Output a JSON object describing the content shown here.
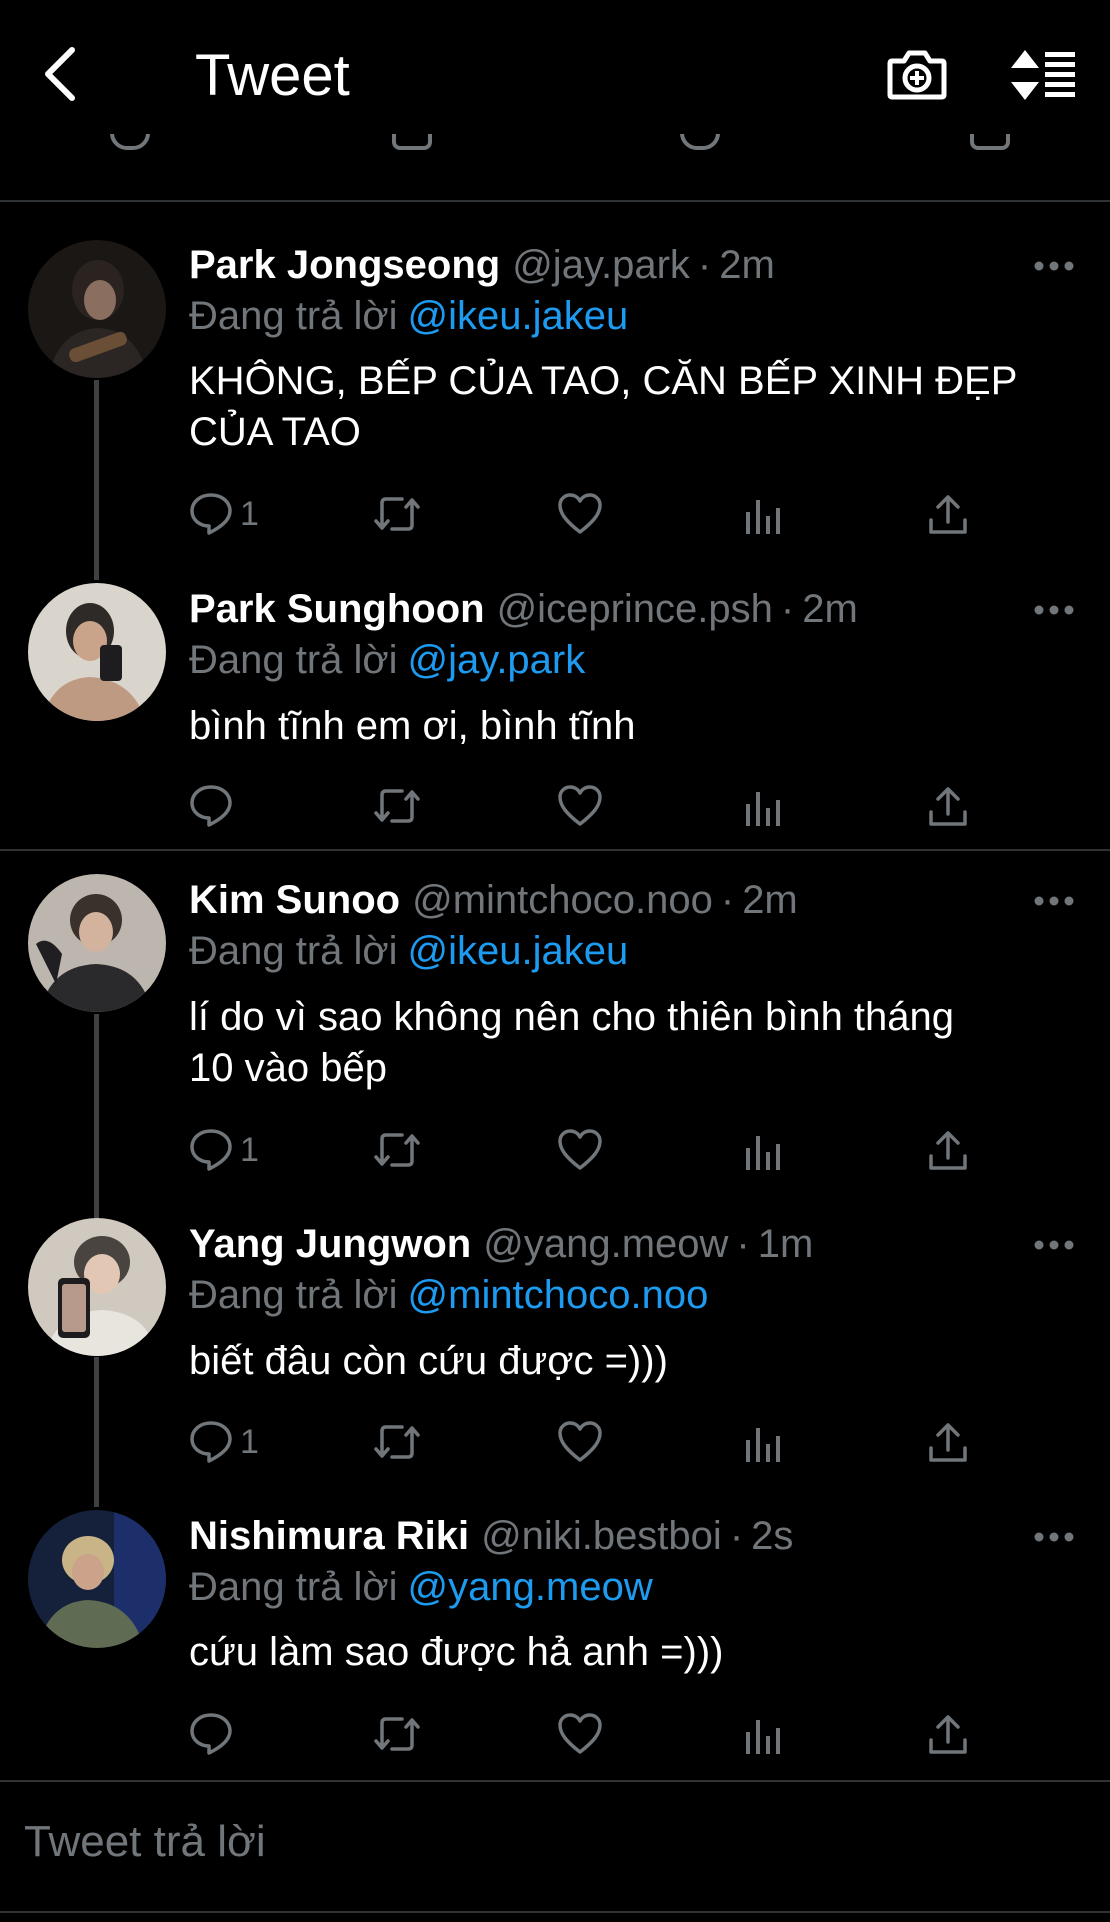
{
  "header": {
    "back_icon": "chevron-left-icon",
    "title": "Tweet",
    "camera_icon": "camera-plus-icon",
    "sort_icon": "sort-list-icon"
  },
  "reply_prefix": "Đang trả lời",
  "tweets": [
    {
      "name": "Park Jongseong",
      "handle": "@jay.park",
      "time": "2m",
      "reply_to": "@ikeu.jakeu",
      "text_lines": [
        "KHÔNG, BẾP CỦA TAO, CĂN BẾP XINH ĐẸP",
        "CỦA TAO"
      ],
      "reply_count": "1"
    },
    {
      "name": "Park Sunghoon",
      "handle": "@iceprince.psh",
      "time": "2m",
      "reply_to": "@jay.park",
      "text_lines": [
        "bình tĩnh em ơi, bình tĩnh"
      ],
      "reply_count": ""
    },
    {
      "name": "Kim Sunoo",
      "handle": "@mintchoco.noo",
      "time": "2m",
      "reply_to": "@ikeu.jakeu",
      "text_lines": [
        "lí do vì sao không nên cho thiên bình tháng",
        "10 vào bếp"
      ],
      "reply_count": "1"
    },
    {
      "name": "Yang Jungwon",
      "handle": "@yang.meow",
      "time": "1m",
      "reply_to": "@mintchoco.noo",
      "text_lines": [
        "biết đâu còn cứu được =)))"
      ],
      "reply_count": "1"
    },
    {
      "name": "Nishimura Riki",
      "handle": "@niki.bestboi",
      "time": "2s",
      "reply_to": "@yang.meow",
      "text_lines": [
        "cứu làm sao được hả anh =)))"
      ],
      "reply_count": ""
    }
  ],
  "action_icons": [
    "comment-icon",
    "retweet-icon",
    "like-heart-icon",
    "analytics-icon",
    "share-icon"
  ],
  "composer": {
    "placeholder": "Tweet trả lời"
  },
  "colors": {
    "background": "#000000",
    "text": "#ffffff",
    "muted": "#71767b",
    "accent": "#1d9bf0",
    "divider": "#2f3336"
  }
}
